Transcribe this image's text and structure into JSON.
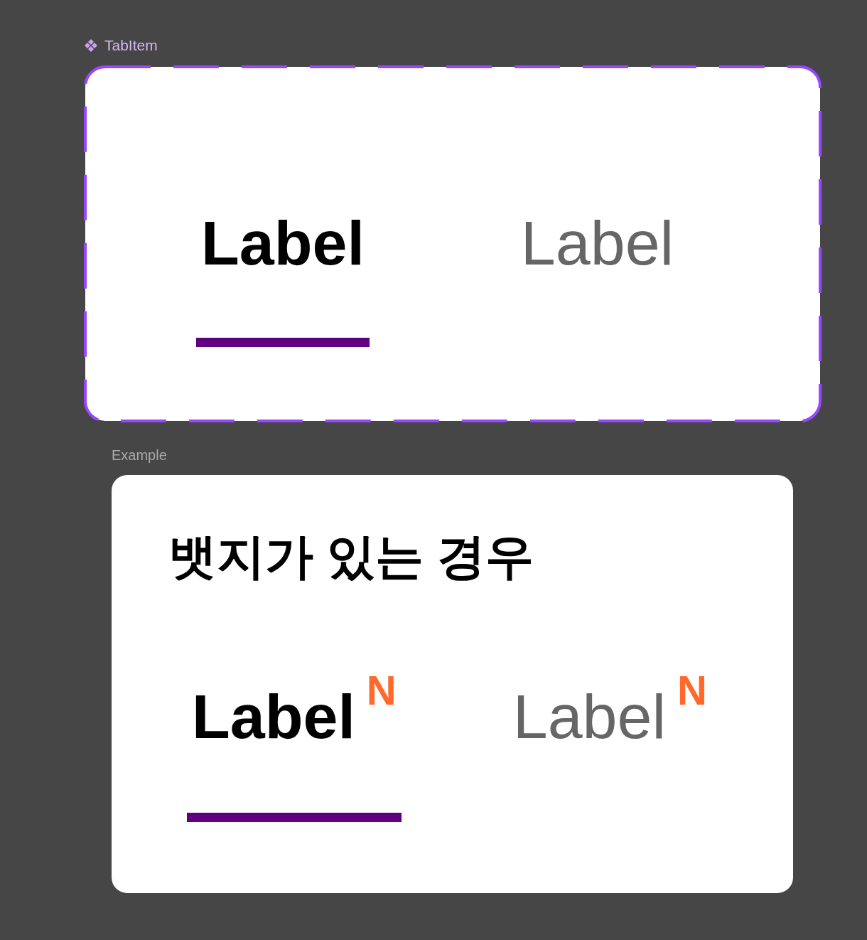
{
  "component": {
    "name": "TabItem",
    "tabs": [
      {
        "label": "Label",
        "selected": true
      },
      {
        "label": "Label",
        "selected": false
      }
    ]
  },
  "example": {
    "caption": "Example",
    "heading": "뱃지가 있는 경우",
    "tabs": [
      {
        "label": "Label",
        "badge": "N",
        "selected": true
      },
      {
        "label": "Label",
        "badge": "N",
        "selected": false
      }
    ]
  }
}
